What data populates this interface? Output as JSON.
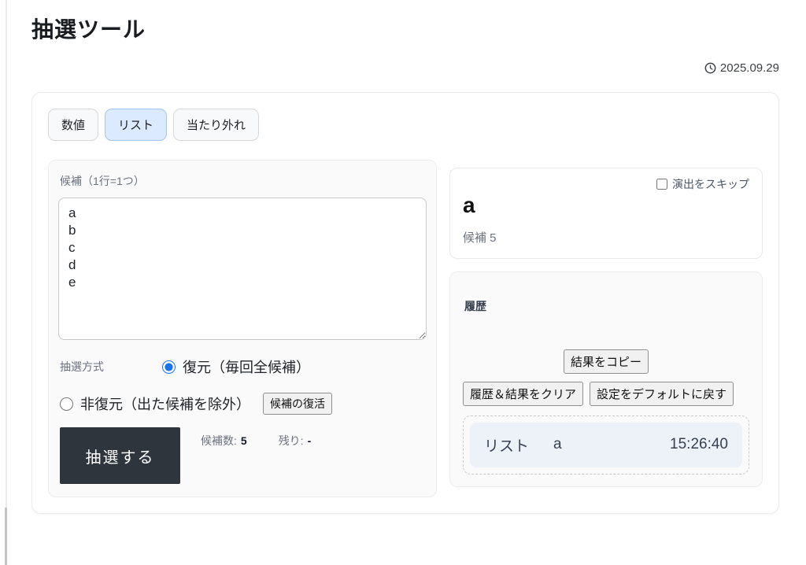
{
  "page": {
    "title": "抽選ツール",
    "date": "2025.09.29"
  },
  "tabs": [
    {
      "label": "数値",
      "active": false
    },
    {
      "label": "リスト",
      "active": true
    },
    {
      "label": "当たり外れ",
      "active": false
    }
  ],
  "candidates": {
    "label": "候補（1行=1つ）",
    "value": "a\nb\nc\nd\ne"
  },
  "method": {
    "label": "抽選方式",
    "options": [
      {
        "label": "復元（毎回全候補）",
        "selected": true
      },
      {
        "label": "非復元（出た候補を除外）",
        "selected": false
      }
    ],
    "restore_button": "候補の復活"
  },
  "draw": {
    "button": "抽選する",
    "count_label": "候補数:",
    "count_value": "5",
    "remain_label": "残り:",
    "remain_value": "-"
  },
  "result": {
    "skip_label": "演出をスキップ",
    "value": "a",
    "meta": "候補 5"
  },
  "history": {
    "title": "履歴",
    "copy_button": "結果をコピー",
    "clear_button": "履歴＆結果をクリア",
    "reset_button": "設定をデフォルトに戻す",
    "entries": [
      {
        "kind": "リスト",
        "value": "a",
        "time": "15:26:40"
      }
    ]
  },
  "icons": {
    "date_icon": "clock-icon"
  },
  "colors": {
    "accent_blue": "#1a73e8",
    "active_tab_bg": "#dbeafe",
    "active_tab_border": "#9ec5f8",
    "draw_button_bg": "#2f353c",
    "history_row_bg": "#edf1f8",
    "card_bg": "#fafafa",
    "border": "#ececec"
  }
}
